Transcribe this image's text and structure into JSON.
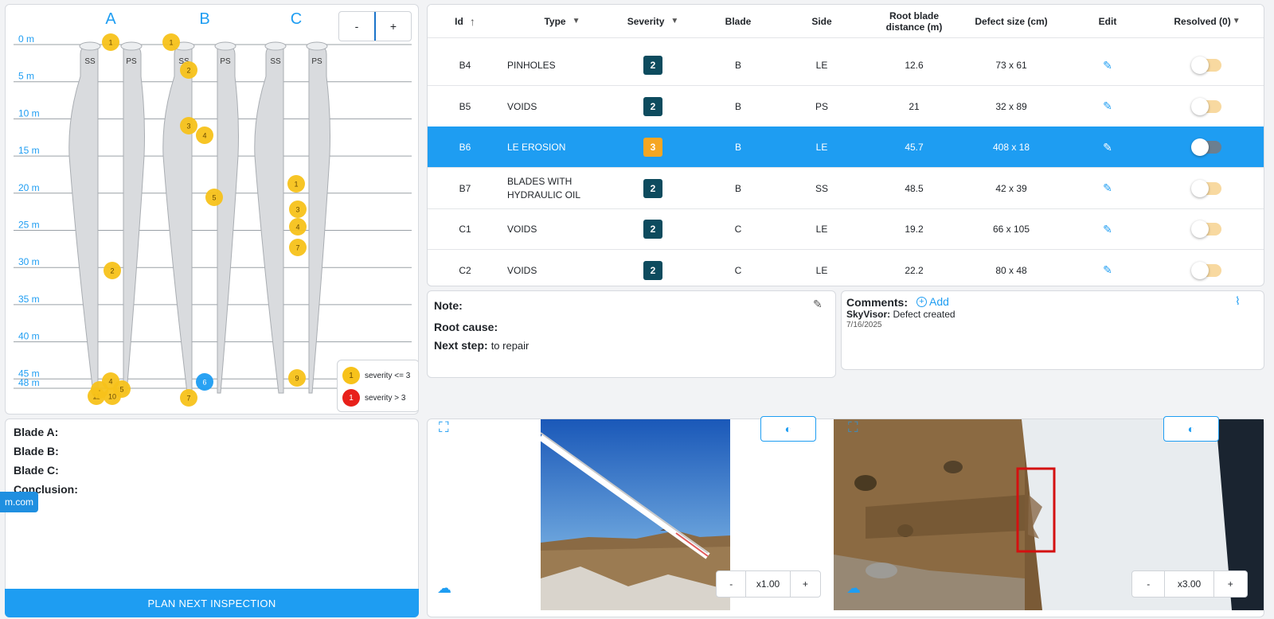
{
  "blade_map": {
    "blade_letters": [
      "A",
      "B",
      "C"
    ],
    "side_labels": [
      "SS",
      "PS"
    ],
    "depth_labels": [
      "0 m",
      "5 m",
      "10 m",
      "15 m",
      "20 m",
      "25 m",
      "30 m",
      "35 m",
      "40 m",
      "45 m",
      "48 m"
    ],
    "zoom_minus": "-",
    "zoom_plus": "+",
    "legend": [
      {
        "label": "severity <= 3",
        "marker": "1",
        "color": "#f7c21a"
      },
      {
        "label": "severity > 3",
        "marker": "1",
        "color": "#e8201a"
      }
    ],
    "colors": {
      "marker_low": "#f7c21a",
      "marker_selected": "#1e9df2",
      "accent": "#1e9df2"
    }
  },
  "summary": {
    "blade_a": "Blade A:",
    "blade_b": "Blade B:",
    "blade_c": "Blade C:",
    "conclusion": "Conclusion:",
    "overlay_chip": "m.com",
    "plan_button": "PLAN NEXT INSPECTION"
  },
  "table": {
    "headers": {
      "id": "Id",
      "type": "Type",
      "severity": "Severity",
      "blade": "Blade",
      "side": "Side",
      "root_distance_line1": "Root blade",
      "root_distance_line2": "distance (m)",
      "defect_size": "Defect size (cm)",
      "edit": "Edit",
      "resolved": "Resolved (0)"
    },
    "rows": [
      {
        "id": "B4",
        "type": "PINHOLES",
        "type2": "",
        "severity": "2",
        "blade": "B",
        "side": "LE",
        "distance": "12.6",
        "size": "73 x 61"
      },
      {
        "id": "B5",
        "type": "VOIDS",
        "type2": "",
        "severity": "2",
        "blade": "B",
        "side": "PS",
        "distance": "21",
        "size": "32 x 89"
      },
      {
        "id": "B6",
        "type": "LE EROSION",
        "type2": "",
        "severity": "3",
        "blade": "B",
        "side": "LE",
        "distance": "45.7",
        "size": "408 x 18"
      },
      {
        "id": "B7",
        "type": "BLADES WITH",
        "type2": "HYDRAULIC OIL",
        "severity": "2",
        "blade": "B",
        "side": "SS",
        "distance": "48.5",
        "size": "42 x 39"
      },
      {
        "id": "C1",
        "type": "VOIDS",
        "type2": "",
        "severity": "2",
        "blade": "C",
        "side": "LE",
        "distance": "19.2",
        "size": "66 x 105"
      },
      {
        "id": "C2",
        "type": "VOIDS",
        "type2": "",
        "severity": "2",
        "blade": "C",
        "side": "LE",
        "distance": "22.2",
        "size": "80 x 48"
      }
    ],
    "selected_id": "B6"
  },
  "details": {
    "note_label": "Note:",
    "root_cause_label": "Root cause:",
    "next_step_label": "Next step:",
    "next_step_value": "to repair",
    "comments_label": "Comments:",
    "add_label": "Add",
    "comment_author": "SkyVisor:",
    "comment_text": "Defect created",
    "comment_date": "7/16/2025"
  },
  "images": {
    "left_zoom": "x1.00",
    "right_zoom": "x3.00",
    "minus": "-",
    "plus": "+"
  }
}
